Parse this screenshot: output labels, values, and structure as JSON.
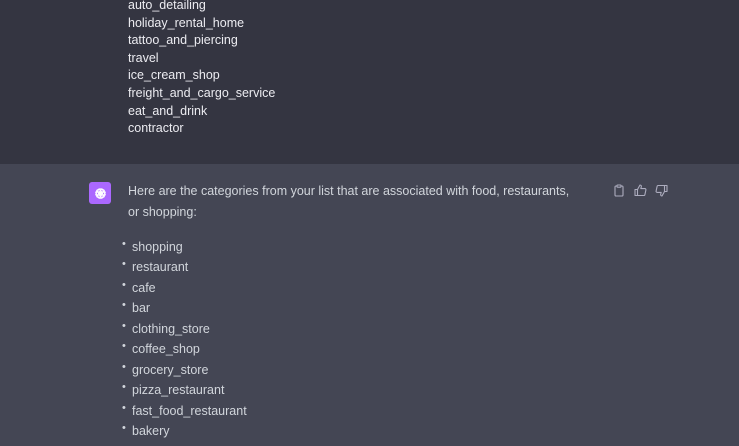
{
  "user_message": {
    "items": [
      "auto_detailing",
      "holiday_rental_home",
      "tattoo_and_piercing",
      "travel",
      "ice_cream_shop",
      "freight_and_cargo_service",
      "eat_and_drink",
      "contractor"
    ]
  },
  "assistant_message": {
    "intro": "Here are the categories from your list that are associated with food, restaurants, or shopping:",
    "items": [
      "shopping",
      "restaurant",
      "cafe",
      "bar",
      "clothing_store",
      "coffee_shop",
      "grocery_store",
      "pizza_restaurant",
      "fast_food_restaurant",
      "bakery"
    ],
    "avatar_color": "#ab68ff"
  },
  "actions": {
    "copy_icon": "clipboard-icon",
    "like_icon": "thumbs-up-icon",
    "dislike_icon": "thumbs-down-icon"
  },
  "colors": {
    "user_bg": "#343541",
    "assistant_bg": "#444654",
    "text": "#d1d5db"
  }
}
